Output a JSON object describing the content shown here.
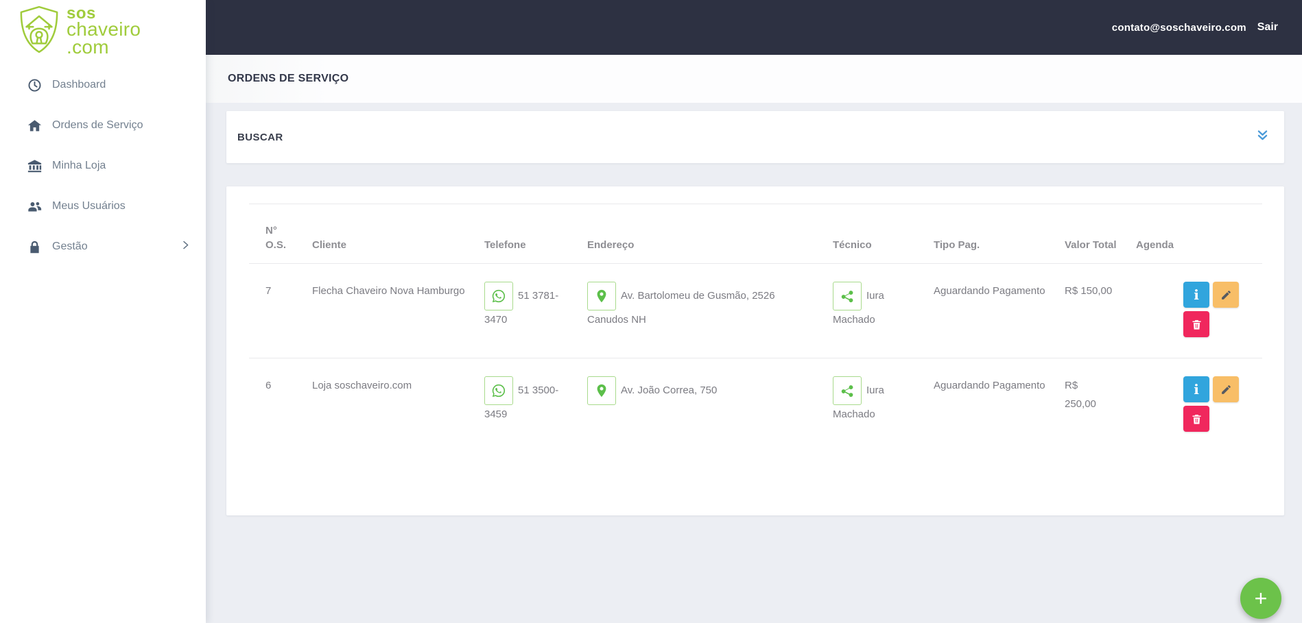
{
  "brand": {
    "line1": "sos",
    "line2": "chaveiro",
    "line3": ".com",
    "color": "#a0cc3c"
  },
  "topbar": {
    "email": "contato@soschaveiro.com",
    "logout_label": "Sair",
    "background": "#2d3142"
  },
  "sidebar": {
    "items": [
      {
        "label": "Dashboard",
        "icon": "clock-icon"
      },
      {
        "label": "Ordens de Serviço",
        "icon": "home-icon"
      },
      {
        "label": "Minha Loja",
        "icon": "bank-icon"
      },
      {
        "label": "Meus Usuários",
        "icon": "users-icon"
      },
      {
        "label": "Gestão",
        "icon": "lock-icon",
        "has_submenu": true
      }
    ]
  },
  "page": {
    "title": "ORDENS DE SERVIÇO"
  },
  "search_panel": {
    "title": "BUSCAR",
    "chevron_color": "#4a9ad8"
  },
  "table": {
    "headers": [
      "N° O.S.",
      "Cliente",
      "Telefone",
      "Endereço",
      "Técnico",
      "Tipo Pag.",
      "Valor Total",
      "Agenda"
    ],
    "rows": [
      {
        "os_number": "7",
        "cliente": "Flecha Chaveiro Nova Hamburgo",
        "telefone": "51 3781-3470",
        "endereco": "Av. Bartolomeu de Gusmão, 2526 Canudos NH",
        "tecnico": "Iura Machado",
        "tipo_pag": "Aguardando Pagamento",
        "valor_total": "R$ 150,00"
      },
      {
        "os_number": "6",
        "cliente": "Loja soschaveiro.com",
        "telefone": "51 3500-3459",
        "endereco": "Av. João Correa, 750",
        "tecnico": "Iura Machado",
        "tipo_pag": "Aguardando Pagamento",
        "valor_total": "R$\n250,00"
      }
    ],
    "action_icons": [
      "info-icon",
      "pencil-icon",
      "trash-icon"
    ],
    "action_colors": {
      "info": "#31a5dd",
      "edit": "#f8be67",
      "delete": "#f0275d"
    },
    "row_icon_color": "#5cbf4a"
  },
  "fab": {
    "label": "+",
    "color": "#6cc24a"
  }
}
